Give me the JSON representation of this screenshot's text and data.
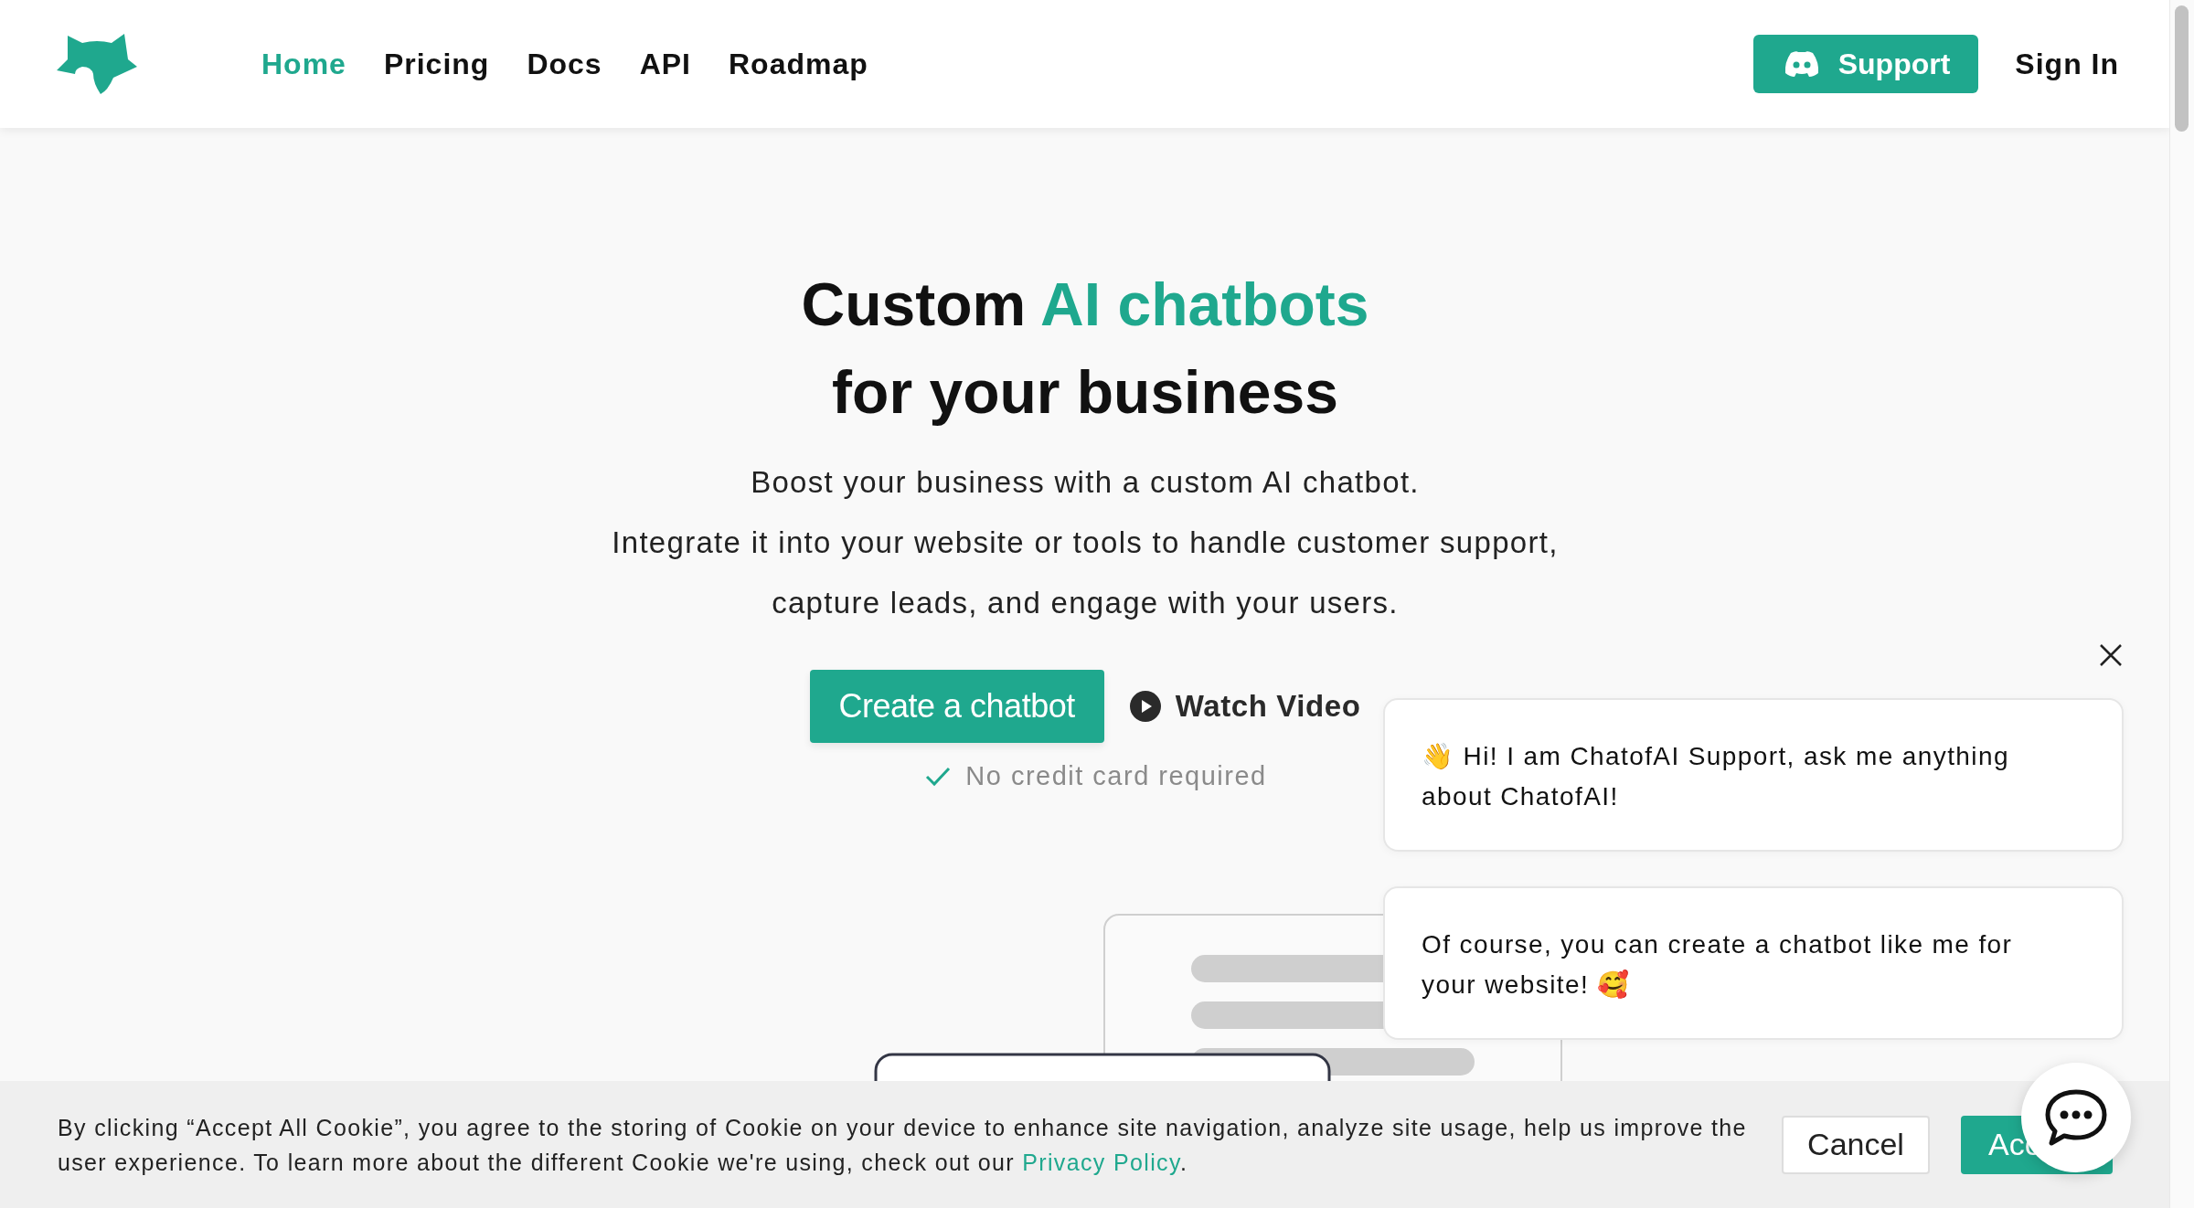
{
  "nav": {
    "items": [
      {
        "label": "Home",
        "selected": true
      },
      {
        "label": "Pricing",
        "selected": false
      },
      {
        "label": "Docs",
        "selected": false
      },
      {
        "label": "API",
        "selected": false
      },
      {
        "label": "Roadmap",
        "selected": false
      }
    ]
  },
  "actions": {
    "support": "Support",
    "sign_in": "Sign In"
  },
  "hero": {
    "title_lead": "Custom",
    "title_highlight": "AI chatbots",
    "title_line2": "for your business",
    "subtitle": [
      "Boost your business with a custom AI chatbot.",
      "Integrate it into your website or tools to handle customer support,",
      "capture leads, and engage with your users."
    ],
    "primary_button": "Create a chatbot",
    "video_button": "Watch Video",
    "note": "No credit card required"
  },
  "chat": {
    "messages": [
      "👋 Hi! I am ChatofAI Support, ask me anything about ChatofAI!",
      "Of course, you can create a chatbot like me for your website! 🥰"
    ]
  },
  "cookie": {
    "text": "By clicking “Accept All Cookie”, you agree to the storing of Cookie on your device to enhance site navigation, analyze site usage, help us improve the user experience. To learn more about the different Cookie we're using, check out our",
    "link": "Privacy Policy",
    "tail": ".",
    "cancel": "Cancel",
    "accept": "Acc"
  }
}
